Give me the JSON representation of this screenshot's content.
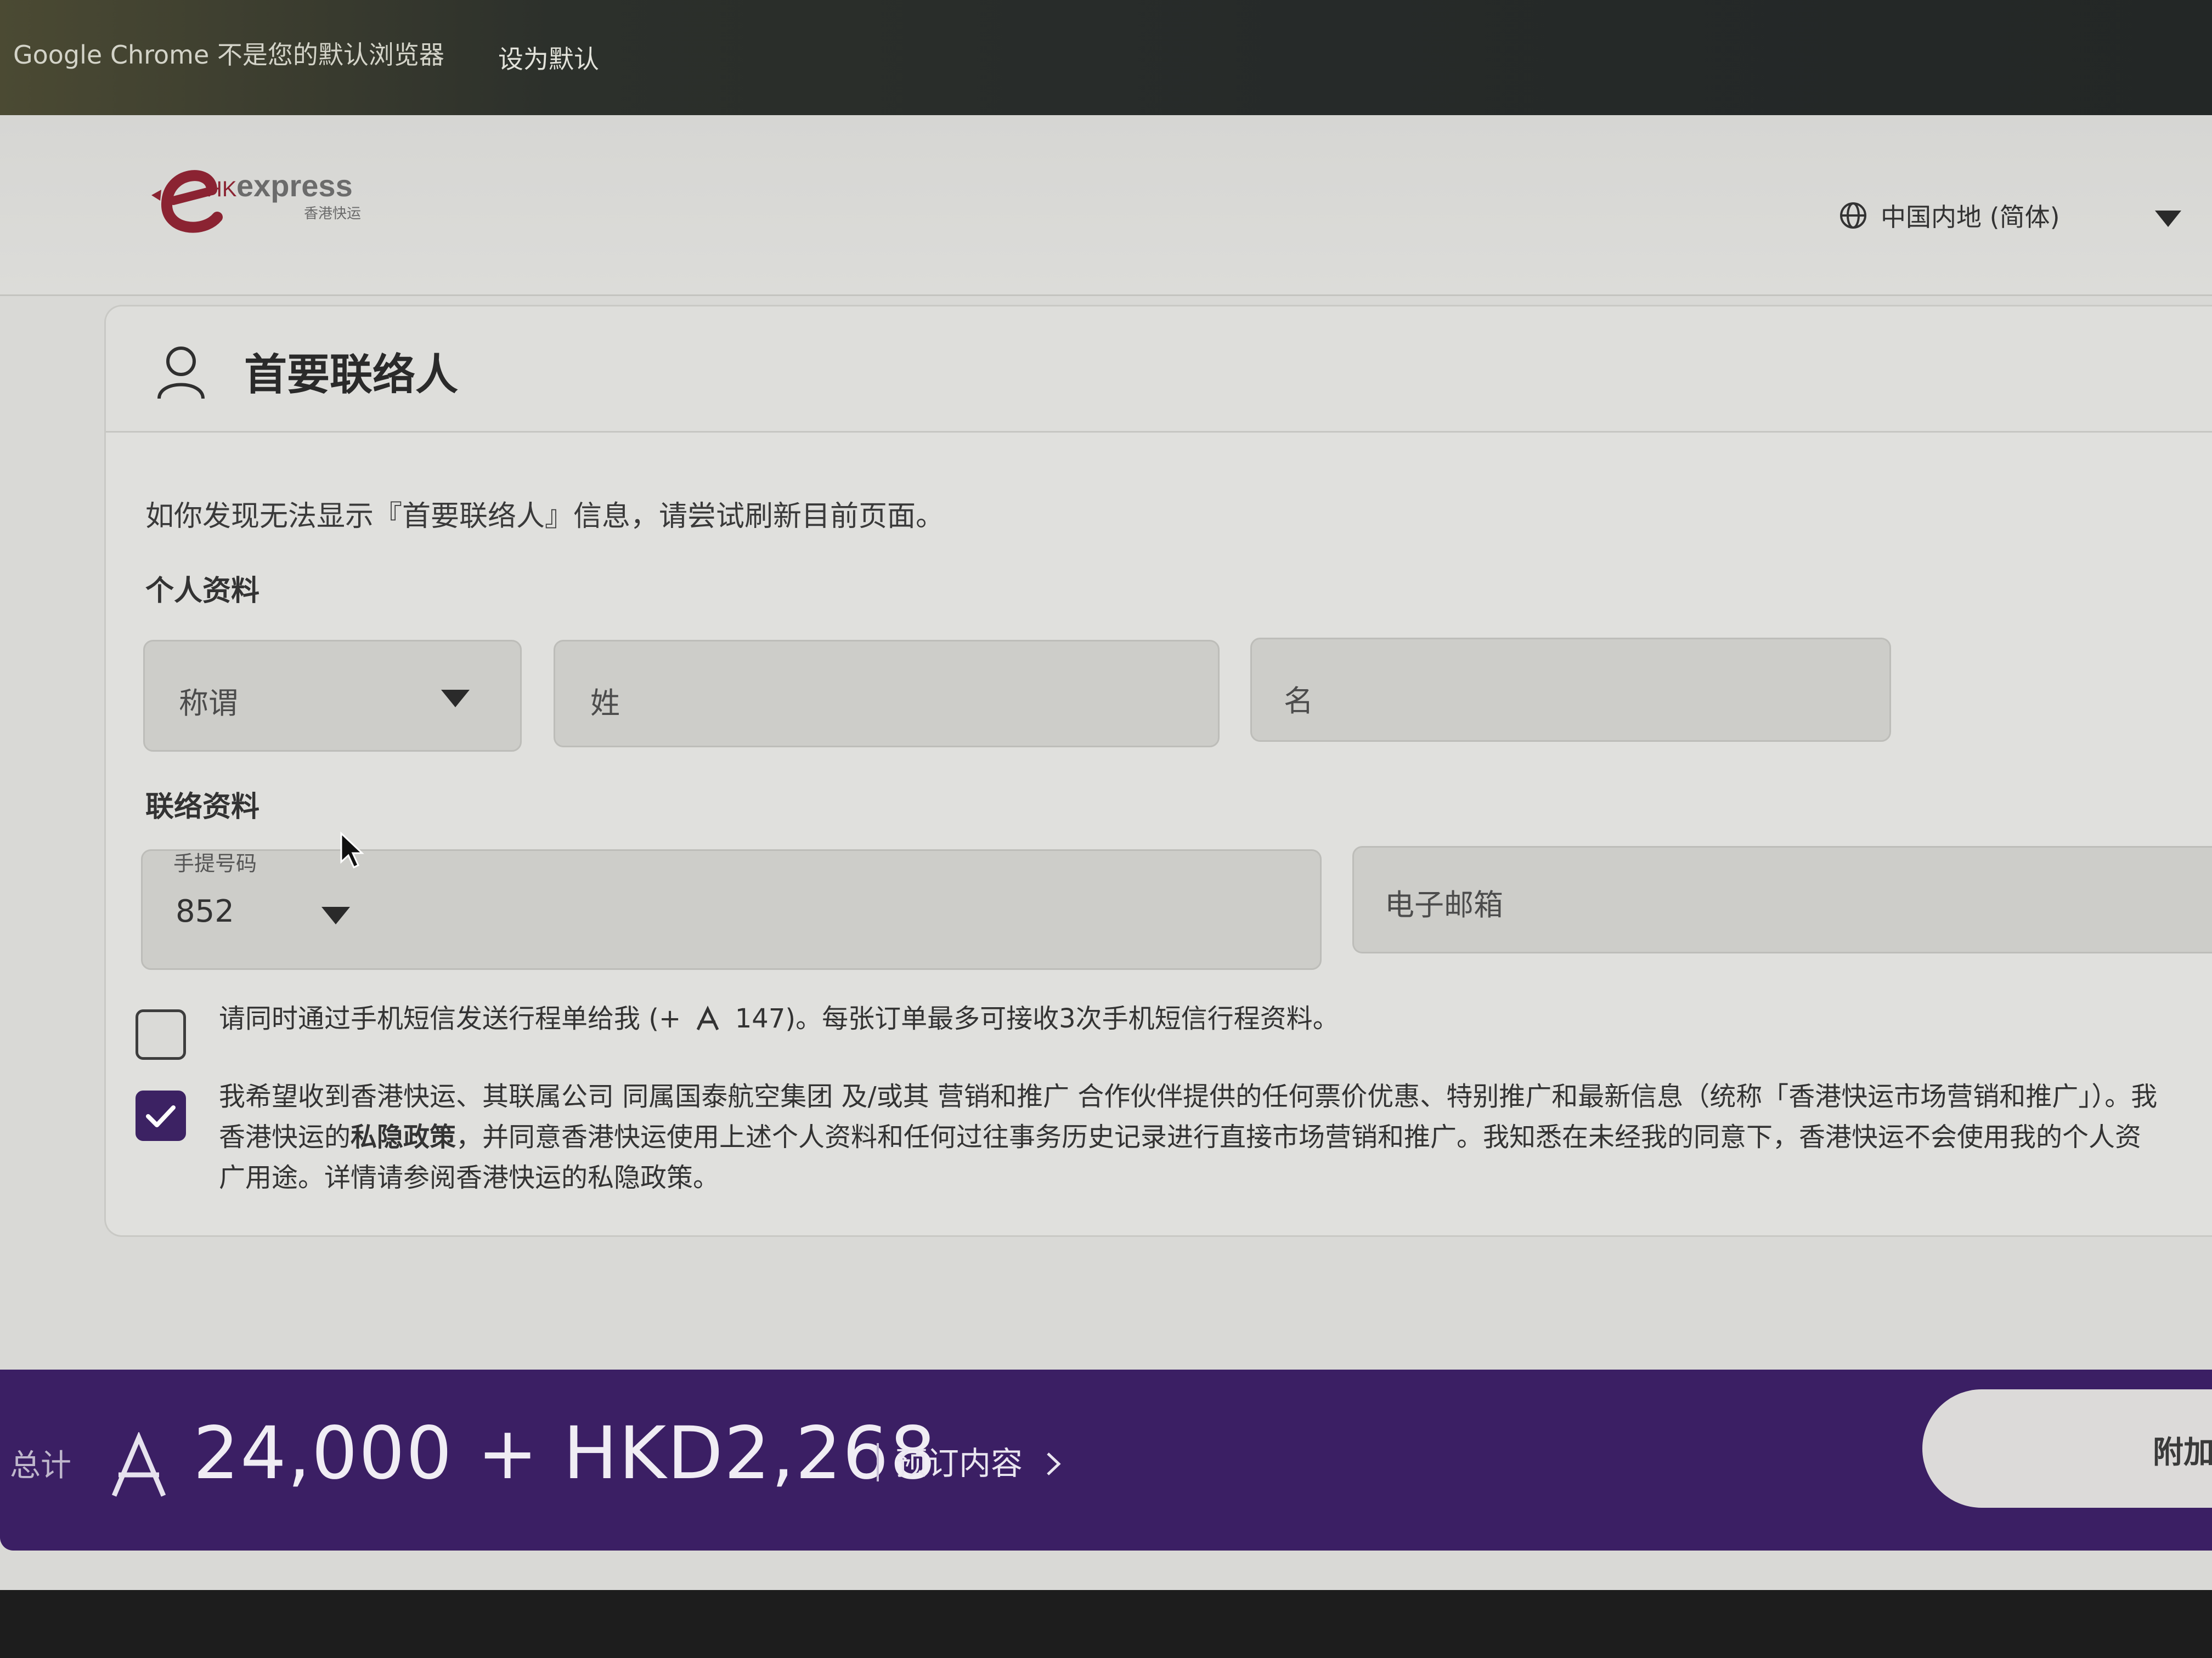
{
  "browser": {
    "infobar_message": "Google Chrome 不是您的默认浏览器",
    "infobar_button": "设为默认"
  },
  "header": {
    "logo_main": "HKexpress",
    "logo_sub": "香港快运",
    "language": "中国内地 (简体)"
  },
  "contact": {
    "title": "首要联络人",
    "notice": "如你发现无法显示『首要联络人』信息，请尝试刷新目前页面。",
    "personal_label": "个人资料",
    "salutation_placeholder": "称谓",
    "surname_placeholder": "姓",
    "given_name_placeholder": "名",
    "contact_label": "联络资料",
    "mobile_label": "手提号码",
    "country_code": "852",
    "email_placeholder": "电子邮箱",
    "sms_option": {
      "checked": false,
      "text_before": "请同时通过手机短信发送行程单给我 (+",
      "text_after": "147)。每张订单最多可接收3次手机短信行程资料。"
    },
    "marketing_option": {
      "checked": true,
      "line1": "我希望收到香港快运、其联属公司 同属国泰航空集团 及/或其 营销和推广 合作伙伴提供的任何票价优惠、特别推广和最新信息（统称「香港快运市场营销和推广」）。我",
      "line2_prefix": "香港快运的",
      "line2_bold": "私隐政策",
      "line2_rest": "，并同意香港快运使用上述个人资料和任何过往事务历史记录进行直接市场营销和推广。我知悉在未经我的同意下，香港快运不会使用我的个人资",
      "line3": "广用途。详情请参阅香港快运的私隐政策。"
    }
  },
  "footer_bar": {
    "total_label": "总计",
    "miles": "24,000",
    "plus": "+",
    "currency": "HKD",
    "price": "2,268",
    "summary_link": "预订内容",
    "next_button": "附加"
  },
  "colors": {
    "brand_purple": "#3b1f64",
    "checkbox_checked": "#3c2263",
    "logo_red": "#8b2332"
  }
}
